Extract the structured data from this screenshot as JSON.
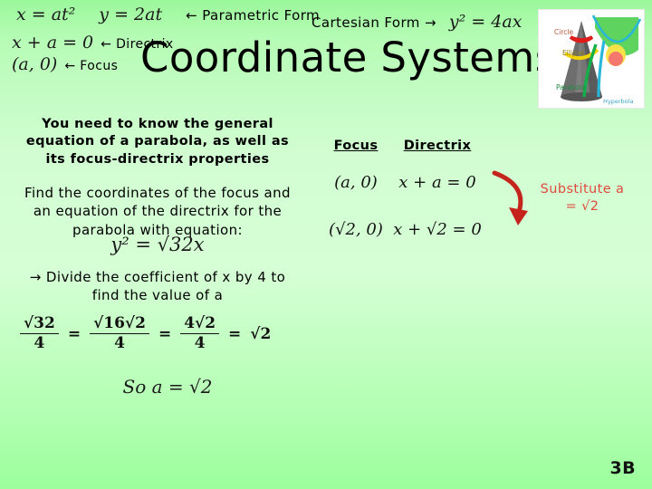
{
  "slide": {
    "title": "Coordinate Systems",
    "number": "3B",
    "background_top_color": "#9bf89b",
    "background_mid_color": "#d6ffd6",
    "background_bottom_color": "#9cff9c"
  },
  "header": {
    "parametric": {
      "eq_x": "x = at²",
      "eq_y": "y = 2at",
      "label": "← Parametric Form"
    },
    "directrix": {
      "equation": "x + a = 0",
      "label": "← Directrix"
    },
    "focus": {
      "point": "(a, 0)",
      "label": "← Focus"
    },
    "cartesian": {
      "label": "Cartesian Form →",
      "equation": "y² = 4ax"
    }
  },
  "conic_figure": {
    "name": "conic-sections-diagram",
    "labels": {
      "circle": "Circle",
      "ellipse": "Ellipse",
      "parabola": "Parabola",
      "hyperbola": "Hyperbola"
    },
    "colors": {
      "circle": "#e01b1b",
      "ellipse": "#f2d200",
      "parabola": "#13b04a",
      "hyperbola": "#29b6d8",
      "cone": "#6e6e6e",
      "panel": "#ffffff"
    }
  },
  "body": {
    "need_to_know": "You need to know the general equation of a parabola, as well as its focus-directrix properties",
    "question": "Find the coordinates of the focus and an equation of the directrix for the parabola with equation:",
    "given_equation": "y² = √32x",
    "divide_hint": "→ Divide the coefficient of x by 4 to find the value of a",
    "conclusion": "So a = √2"
  },
  "work_chain": {
    "steps": [
      {
        "type": "fraction",
        "numerator": "√32",
        "denominator": "4"
      },
      {
        "type": "operator",
        "text": "="
      },
      {
        "type": "fraction",
        "numerator": "√16√2",
        "denominator": "4"
      },
      {
        "type": "operator",
        "text": "="
      },
      {
        "type": "fraction",
        "numerator": "4√2",
        "denominator": "4"
      },
      {
        "type": "operator",
        "text": "="
      },
      {
        "type": "value",
        "text": "√2"
      }
    ]
  },
  "results": {
    "headers": {
      "focus": "Focus",
      "directrix": "Directrix"
    },
    "general_row": {
      "focus": "(a, 0)",
      "directrix": "x + a = 0"
    },
    "solved_row": {
      "focus": "(√2, 0)",
      "directrix": "x + √2 = 0"
    }
  },
  "annotation": {
    "substitute_line1": "Substitute a",
    "substitute_line2": "= √2",
    "color": "#e04a3c",
    "arrow_color": "#c5241c"
  }
}
